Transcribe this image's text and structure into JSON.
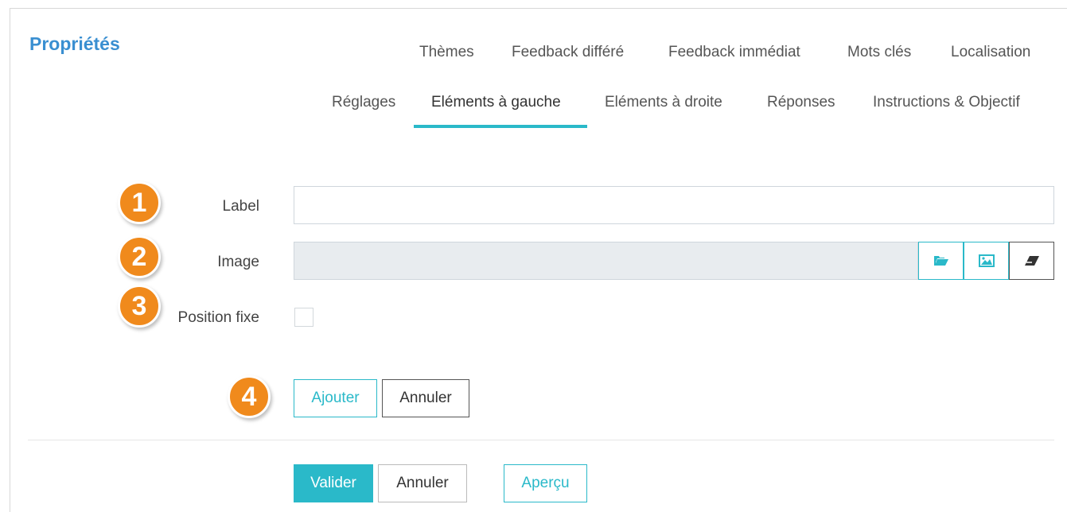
{
  "header": {
    "title": "Propriétés"
  },
  "tabs_row1": [
    "Thèmes",
    "Feedback différé",
    "Feedback immédiat",
    "Mots clés",
    "Localisation"
  ],
  "tabs_row2": [
    "Réglages",
    "Eléments à gauche",
    "Eléments à droite",
    "Réponses",
    "Instructions & Objectif"
  ],
  "active_tab": "Eléments à gauche",
  "badges": [
    "1",
    "2",
    "3",
    "4"
  ],
  "form": {
    "label_label": "Label",
    "label_value": "",
    "image_label": "Image",
    "image_value": "",
    "position_label": "Position fixe",
    "position_checked": false,
    "icons": [
      "folder-open-icon",
      "image-icon",
      "eraser-icon"
    ],
    "add_label": "Ajouter",
    "cancel_label": "Annuler"
  },
  "footer": {
    "validate_label": "Valider",
    "cancel_label": "Annuler",
    "preview_label": "Aperçu"
  },
  "colors": {
    "accent": "#2ab9c9",
    "title": "#3a8fd1",
    "badge": "#f08a1c"
  }
}
